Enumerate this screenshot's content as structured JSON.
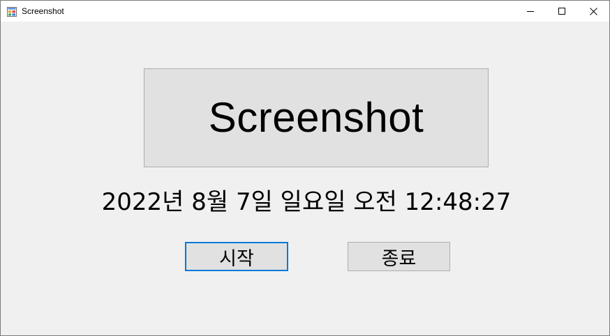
{
  "window": {
    "title": "Screenshot",
    "app_icon": "winforms-app-icon",
    "controls": {
      "minimize_icon": "minimize-icon",
      "maximize_icon": "maximize-icon",
      "close_icon": "close-icon"
    }
  },
  "main": {
    "headline": "Screenshot",
    "datetime": "2022년 8월 7일 일요일 오전 12:48:27",
    "start_button_label": "시작",
    "exit_button_label": "종료"
  },
  "colors": {
    "client_background": "#f0f0f0",
    "button_face": "#e1e1e1",
    "button_border": "#adadad",
    "focus_border": "#0078d7",
    "titlebar_background": "#ffffff"
  }
}
